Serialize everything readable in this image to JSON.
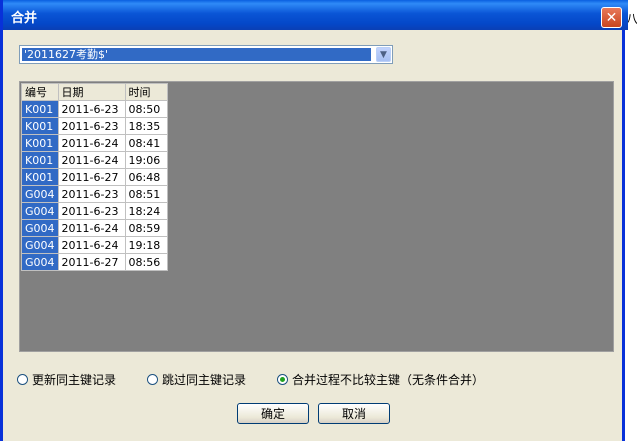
{
  "window": {
    "title": "合并",
    "outside_text": "八"
  },
  "combo": {
    "value": "'2011627考勤$'"
  },
  "grid": {
    "columns": [
      "编号",
      "日期",
      "时间"
    ],
    "rows": [
      [
        "K001",
        "2011-6-23",
        "08:50"
      ],
      [
        "K001",
        "2011-6-23",
        "18:35"
      ],
      [
        "K001",
        "2011-6-24",
        "08:41"
      ],
      [
        "K001",
        "2011-6-24",
        "19:06"
      ],
      [
        "K001",
        "2011-6-27",
        "06:48"
      ],
      [
        "G004",
        "2011-6-23",
        "08:51"
      ],
      [
        "G004",
        "2011-6-23",
        "18:24"
      ],
      [
        "G004",
        "2011-6-24",
        "08:59"
      ],
      [
        "G004",
        "2011-6-24",
        "19:18"
      ],
      [
        "G004",
        "2011-6-27",
        "08:56"
      ]
    ]
  },
  "options": [
    {
      "label": "更新同主键记录",
      "selected": false
    },
    {
      "label": "跳过同主键记录",
      "selected": false
    },
    {
      "label": "合并过程不比较主键（无条件合并）",
      "selected": true
    }
  ],
  "buttons": {
    "ok": "确定",
    "cancel": "取消"
  },
  "icons": {
    "close": "close-icon",
    "dropdown": "chevron-down-icon"
  },
  "colors": {
    "titlebar": "#0a55d6",
    "selection": "#316ac5",
    "grid_background": "#808080",
    "dialog": "#ece9d8"
  }
}
